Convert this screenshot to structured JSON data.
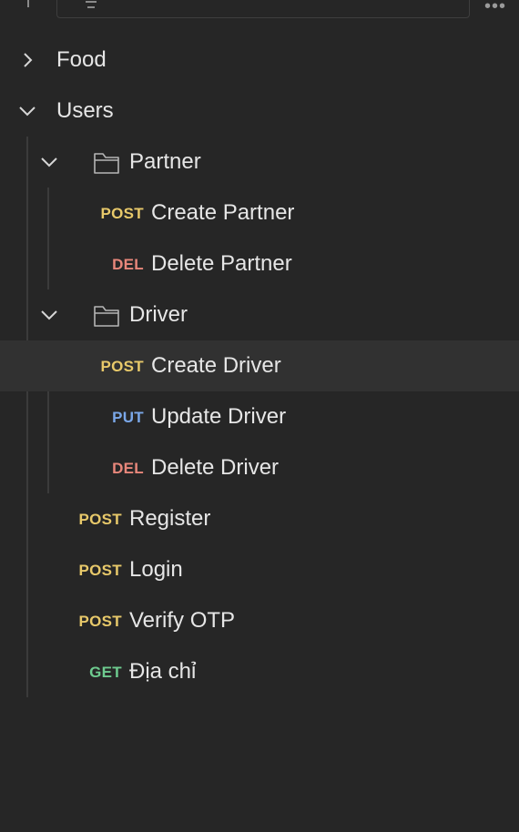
{
  "collections": [
    {
      "id": "food",
      "label": "Food",
      "expanded": false
    },
    {
      "id": "users",
      "label": "Users",
      "expanded": true
    }
  ],
  "folders": {
    "partner": {
      "label": "Partner",
      "expanded": true
    },
    "driver": {
      "label": "Driver",
      "expanded": true
    }
  },
  "partner_requests": [
    {
      "method": "POST",
      "label": "Create Partner"
    },
    {
      "method": "DEL",
      "label": "Delete Partner"
    }
  ],
  "driver_requests": [
    {
      "method": "POST",
      "label": "Create Driver",
      "selected": true
    },
    {
      "method": "PUT",
      "label": "Update Driver"
    },
    {
      "method": "DEL",
      "label": "Delete Driver"
    }
  ],
  "user_requests": [
    {
      "method": "POST",
      "label": "Register"
    },
    {
      "method": "POST",
      "label": "Login"
    },
    {
      "method": "POST",
      "label": "Verify OTP"
    },
    {
      "method": "GET",
      "label": "Địa chỉ"
    }
  ],
  "method_colors": {
    "POST": "#e8c96a",
    "DEL": "#e8877b",
    "PUT": "#7aa7e8",
    "GET": "#6ecb8f"
  },
  "icons": {
    "collapsed": "chevron-right-icon",
    "expanded": "chevron-down-icon",
    "folder": "folder-icon",
    "filter": "filter-icon",
    "more": "more-icon"
  }
}
